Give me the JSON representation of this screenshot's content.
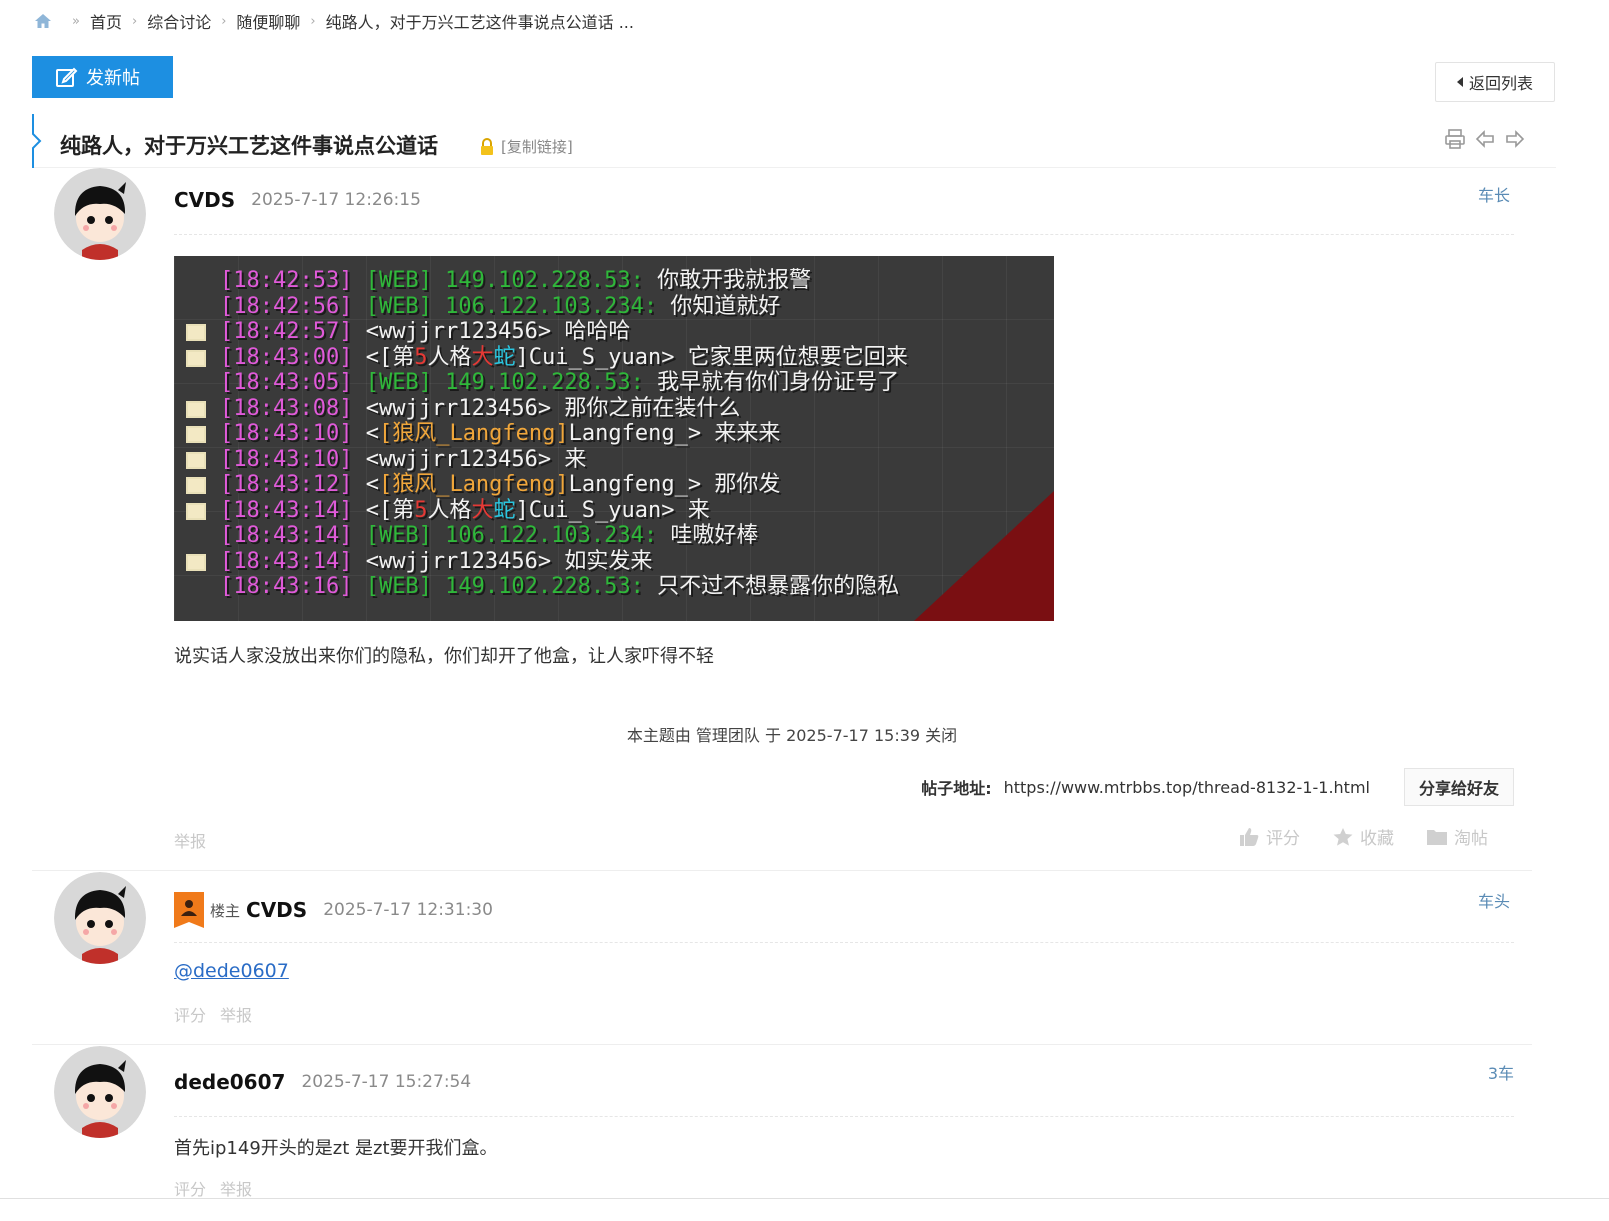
{
  "breadcrumb": {
    "items": [
      "首页",
      "综合讨论",
      "随便聊聊",
      "纯路人，对于万兴工艺这件事说点公道话 ..."
    ]
  },
  "toolbar": {
    "new_post": "发新帖",
    "back_to_list": "返回列表"
  },
  "thread": {
    "title": "纯路人，对于万兴工艺这件事说点公道话",
    "copy_link": "[复制链接]",
    "closed_note": "本主题由 管理团队 于 2025-7-17 15:39 关闭",
    "address_label": "帖子地址:",
    "address_url": "https://www.mtrbbs.top/thread-8132-1-1.html",
    "share_label": "分享给好友"
  },
  "posts": [
    {
      "author": "CVDS",
      "time": "2025-7-17 12:26:15",
      "floor": "车长",
      "body": "说实话人家没放出来你们的隐私，你们却开了他盒，让人家吓得不轻",
      "report": "举报",
      "actions": [
        "评分",
        "收藏",
        "淘帖"
      ]
    },
    {
      "op_label": "楼主",
      "author": "CVDS",
      "time": "2025-7-17 12:31:30",
      "floor": "车头",
      "mention": "@dede0607",
      "actions": [
        "评分",
        "举报"
      ]
    },
    {
      "author": "dede0607",
      "time": "2025-7-17 15:27:54",
      "floor": "3车",
      "body": "首先ip149开头的是zt 是zt要开我们盒。",
      "actions": [
        "评分",
        "举报"
      ]
    }
  ],
  "chat_log": [
    {
      "head": false,
      "ts": "[18:42:53]",
      "src": "[WEB] 149.102.228.53:",
      "msg": " 你敢开我就报警"
    },
    {
      "head": false,
      "ts": "[18:42:56]",
      "src": "[WEB] 106.122.103.234:",
      "msg": " 你知道就好"
    },
    {
      "head": true,
      "ts": "[18:42:57]",
      "name": " <wwjjrr123456>",
      "msg": " 哈哈哈"
    },
    {
      "head": true,
      "ts": "[18:43:00]",
      "pre": " <[第",
      "r1": "5",
      "mid": "人格",
      "r2": "大",
      "c1": "蛇",
      "post": "]Cui_S_yuan>",
      "msg": " 它家里两位想要它回来"
    },
    {
      "head": false,
      "ts": "[18:43:05]",
      "src": "[WEB] 149.102.228.53:",
      "msg": " 我早就有你们身份证号了"
    },
    {
      "head": true,
      "ts": "[18:43:08]",
      "name": " <wwjjrr123456>",
      "msg": " 那你之前在装什么"
    },
    {
      "head": true,
      "ts": "[18:43:10]",
      "pre": " <",
      "gold": "[狼风_Langfeng]",
      "post": "Langfeng_>",
      "msg": " 来来来"
    },
    {
      "head": true,
      "ts": "[18:43:10]",
      "name": " <wwjjrr123456>",
      "msg": " 来"
    },
    {
      "head": true,
      "ts": "[18:43:12]",
      "pre": " <",
      "gold": "[狼风_Langfeng]",
      "post": "Langfeng_>",
      "msg": " 那你发"
    },
    {
      "head": true,
      "ts": "[18:43:14]",
      "pre": " <[第",
      "r1": "5",
      "mid": "人格",
      "r2": "大",
      "c1": "蛇",
      "post": "]Cui_S_yuan>",
      "msg": " 来"
    },
    {
      "head": false,
      "ts": "[18:43:14]",
      "src": "[WEB] 106.122.103.234:",
      "msg": " 哇嗷好棒"
    },
    {
      "head": true,
      "ts": "[18:43:14]",
      "name": " <wwjjrr123456>",
      "msg": " 如实发来"
    },
    {
      "head": false,
      "ts": "[18:43:16]",
      "src": "[WEB] 149.102.228.53:",
      "msg": " 只不过不想暴露你的隐私"
    }
  ],
  "colors": {
    "accent": "#1d8fe1",
    "floor": "#5a8bb5",
    "muted": "#c8c8c8"
  }
}
